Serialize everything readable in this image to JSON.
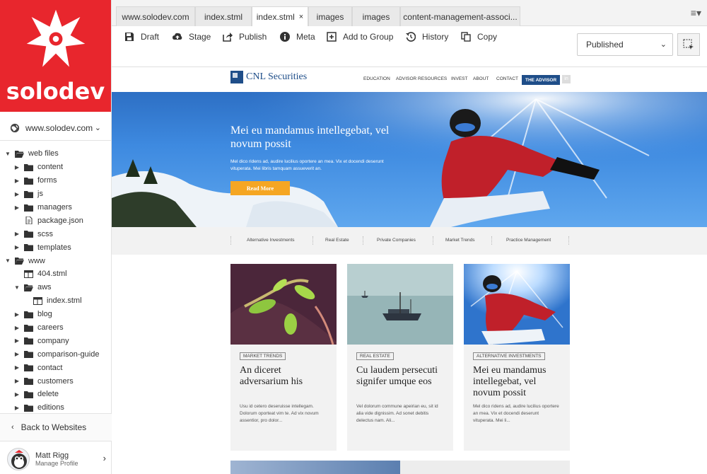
{
  "sidebar": {
    "logo_text": "solodev",
    "site_select": {
      "value": "www.solodev.com",
      "icon": "globe-icon"
    },
    "tree": [
      {
        "label": "web files",
        "level": 0,
        "type": "folder-open",
        "expanded": true
      },
      {
        "label": "content",
        "level": 1,
        "type": "folder",
        "expanded": false
      },
      {
        "label": "forms",
        "level": 1,
        "type": "folder",
        "expanded": false
      },
      {
        "label": "js",
        "level": 1,
        "type": "folder",
        "expanded": false
      },
      {
        "label": "managers",
        "level": 1,
        "type": "folder",
        "expanded": false
      },
      {
        "label": "package.json",
        "level": 1,
        "type": "file",
        "expanded": false
      },
      {
        "label": "scss",
        "level": 1,
        "type": "folder",
        "expanded": false
      },
      {
        "label": "templates",
        "level": 1,
        "type": "folder",
        "expanded": false
      },
      {
        "label": "www",
        "level": 0,
        "type": "folder-open",
        "expanded": true
      },
      {
        "label": "404.stml",
        "level": 1,
        "type": "page",
        "expanded": false
      },
      {
        "label": "aws",
        "level": 1,
        "type": "folder-open",
        "expanded": true
      },
      {
        "label": "index.stml",
        "level": 2,
        "type": "page",
        "expanded": false
      },
      {
        "label": "blog",
        "level": 1,
        "type": "folder",
        "expanded": false
      },
      {
        "label": "careers",
        "level": 1,
        "type": "folder",
        "expanded": false
      },
      {
        "label": "company",
        "level": 1,
        "type": "folder",
        "expanded": false
      },
      {
        "label": "comparison-guide",
        "level": 1,
        "type": "folder",
        "expanded": false
      },
      {
        "label": "contact",
        "level": 1,
        "type": "folder",
        "expanded": false
      },
      {
        "label": "customers",
        "level": 1,
        "type": "folder",
        "expanded": false
      },
      {
        "label": "delete",
        "level": 1,
        "type": "folder",
        "expanded": false
      },
      {
        "label": "editions",
        "level": 1,
        "type": "folder",
        "expanded": false
      }
    ],
    "back_label": "Back to Websites",
    "user": {
      "name": "Matt Rigg",
      "subtitle": "Manage Profile"
    }
  },
  "tabs": [
    {
      "label": "www.solodev.com",
      "active": false
    },
    {
      "label": "index.stml",
      "active": false
    },
    {
      "label": "index.stml",
      "active": true,
      "close": "×"
    },
    {
      "label": "images",
      "active": false
    },
    {
      "label": "images",
      "active": false
    },
    {
      "label": "content-management-associ...",
      "active": false
    }
  ],
  "toolbar": {
    "draft": "Draft",
    "stage": "Stage",
    "publish": "Publish",
    "meta": "Meta",
    "add_to_group": "Add to Group",
    "history": "History",
    "copy": "Copy",
    "status": "Published"
  },
  "preview": {
    "logo": "CNL Securities",
    "nav": [
      "EDUCATION",
      "ADVISOR RESOURCES",
      "INVEST",
      "ABOUT",
      "CONTACT"
    ],
    "nav_cta": "THE ADVISOR",
    "nav_social": "in",
    "hero": {
      "title": "Mei eu mandamus intellegebat, vel novum possit",
      "text": "Mel dico ridens ad, audire lucilius oportere an mea. Vix et docendi deserunt vituperata. Mei libris tamquam assueverit an.",
      "button": "Read More"
    },
    "categories": [
      "Alternative Investments",
      "Real Estate",
      "Private Companies",
      "Market Trends",
      "Practice Management"
    ],
    "cards": [
      {
        "tag": "MARKET TRENDS",
        "title": "An diceret adversarium his",
        "body": "Usu id cetero deseruisse intellegam. Dolorum oporteat vim te. Ad vix novum assentior, pro dolor..."
      },
      {
        "tag": "REAL ESTATE",
        "title": "Cu laudem persecuti signifer umque eos",
        "body": "Vel dolorum commune apeirian eu, sit id alia vide dignissim. Ad sonet debitis delectus nam. Ali..."
      },
      {
        "tag": "ALTERNATIVE INVESTMENTS",
        "title": "Mei eu mandamus intellegebat, vel novum possit",
        "body": "Mel dico ridens ad, audire lucilius oportere an mea. Vix et docendi deserunt vituperata. Mei li..."
      }
    ]
  },
  "colors": {
    "brand_red": "#e8262d",
    "cnl_blue": "#1f4e89",
    "cta_orange": "#f5a623"
  }
}
